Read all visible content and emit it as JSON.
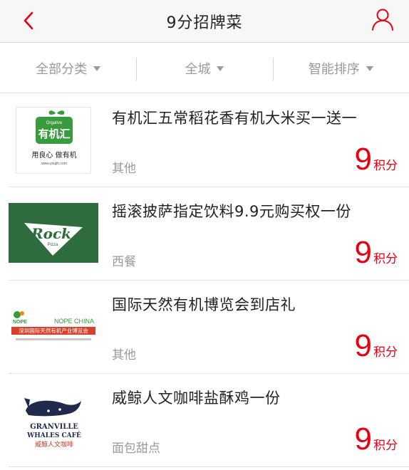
{
  "header": {
    "title": "9分招牌菜",
    "back_icon": "chevron-left-icon",
    "user_icon": "user-icon",
    "accent_color": "#e60012"
  },
  "filters": [
    {
      "label": "全部分类"
    },
    {
      "label": "全城"
    },
    {
      "label": "智能排序"
    }
  ],
  "items": [
    {
      "name": "有机汇五常稻花香有机大米买一送一",
      "category": "其他",
      "points": "9",
      "points_unit": "积分",
      "logo": {
        "brand_small": "Orgalive",
        "brand": "有机汇",
        "slogan": "用良心 做有机",
        "url": "www.youjih.com"
      }
    },
    {
      "name": "摇滚披萨指定饮料9.9元购买权一份",
      "category": "西餐",
      "points": "9",
      "points_unit": "积分",
      "logo": {
        "brand": "Rock",
        "sub": "Pizza"
      }
    },
    {
      "name": "国际天然有机博览会到店礼",
      "category": "其他",
      "points": "9",
      "points_unit": "积分",
      "logo": {
        "mark": "NOPE",
        "brand": "NOPE CHINA",
        "cn": "深圳国际天然有机产业博览会"
      }
    },
    {
      "name": "威鲸人文咖啡盐酥鸡一份",
      "category": "面包甜点",
      "points": "9",
      "points_unit": "积分",
      "logo": {
        "line1": "GRANVILLE",
        "line2": "WHALES CAFÉ",
        "cn": "威鲸人文咖啡"
      }
    }
  ]
}
